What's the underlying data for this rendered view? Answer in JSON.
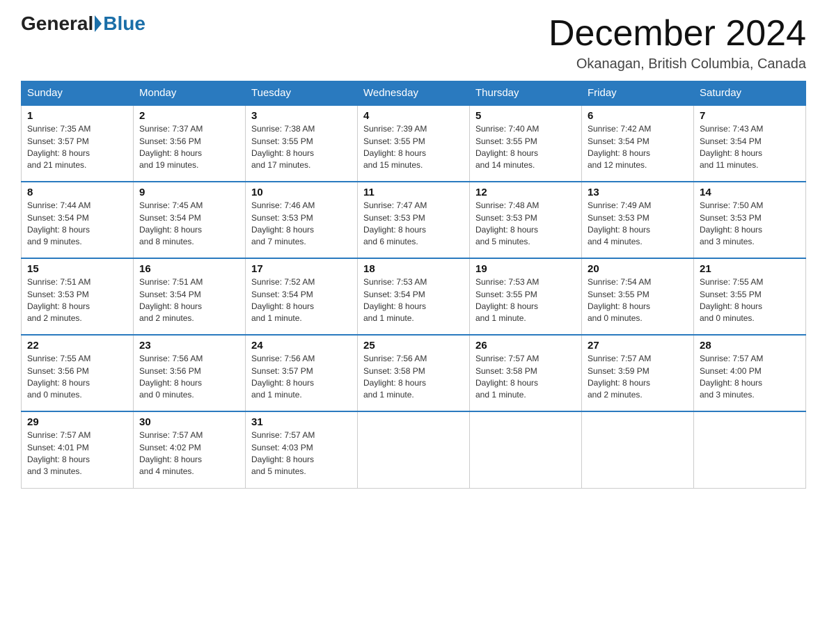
{
  "header": {
    "logo_general": "General",
    "logo_blue": "Blue",
    "month_title": "December 2024",
    "location": "Okanagan, British Columbia, Canada"
  },
  "weekdays": [
    "Sunday",
    "Monday",
    "Tuesday",
    "Wednesday",
    "Thursday",
    "Friday",
    "Saturday"
  ],
  "weeks": [
    [
      {
        "day": "1",
        "sunrise": "7:35 AM",
        "sunset": "3:57 PM",
        "daylight": "8 hours and 21 minutes."
      },
      {
        "day": "2",
        "sunrise": "7:37 AM",
        "sunset": "3:56 PM",
        "daylight": "8 hours and 19 minutes."
      },
      {
        "day": "3",
        "sunrise": "7:38 AM",
        "sunset": "3:55 PM",
        "daylight": "8 hours and 17 minutes."
      },
      {
        "day": "4",
        "sunrise": "7:39 AM",
        "sunset": "3:55 PM",
        "daylight": "8 hours and 15 minutes."
      },
      {
        "day": "5",
        "sunrise": "7:40 AM",
        "sunset": "3:55 PM",
        "daylight": "8 hours and 14 minutes."
      },
      {
        "day": "6",
        "sunrise": "7:42 AM",
        "sunset": "3:54 PM",
        "daylight": "8 hours and 12 minutes."
      },
      {
        "day": "7",
        "sunrise": "7:43 AM",
        "sunset": "3:54 PM",
        "daylight": "8 hours and 11 minutes."
      }
    ],
    [
      {
        "day": "8",
        "sunrise": "7:44 AM",
        "sunset": "3:54 PM",
        "daylight": "8 hours and 9 minutes."
      },
      {
        "day": "9",
        "sunrise": "7:45 AM",
        "sunset": "3:54 PM",
        "daylight": "8 hours and 8 minutes."
      },
      {
        "day": "10",
        "sunrise": "7:46 AM",
        "sunset": "3:53 PM",
        "daylight": "8 hours and 7 minutes."
      },
      {
        "day": "11",
        "sunrise": "7:47 AM",
        "sunset": "3:53 PM",
        "daylight": "8 hours and 6 minutes."
      },
      {
        "day": "12",
        "sunrise": "7:48 AM",
        "sunset": "3:53 PM",
        "daylight": "8 hours and 5 minutes."
      },
      {
        "day": "13",
        "sunrise": "7:49 AM",
        "sunset": "3:53 PM",
        "daylight": "8 hours and 4 minutes."
      },
      {
        "day": "14",
        "sunrise": "7:50 AM",
        "sunset": "3:53 PM",
        "daylight": "8 hours and 3 minutes."
      }
    ],
    [
      {
        "day": "15",
        "sunrise": "7:51 AM",
        "sunset": "3:53 PM",
        "daylight": "8 hours and 2 minutes."
      },
      {
        "day": "16",
        "sunrise": "7:51 AM",
        "sunset": "3:54 PM",
        "daylight": "8 hours and 2 minutes."
      },
      {
        "day": "17",
        "sunrise": "7:52 AM",
        "sunset": "3:54 PM",
        "daylight": "8 hours and 1 minute."
      },
      {
        "day": "18",
        "sunrise": "7:53 AM",
        "sunset": "3:54 PM",
        "daylight": "8 hours and 1 minute."
      },
      {
        "day": "19",
        "sunrise": "7:53 AM",
        "sunset": "3:55 PM",
        "daylight": "8 hours and 1 minute."
      },
      {
        "day": "20",
        "sunrise": "7:54 AM",
        "sunset": "3:55 PM",
        "daylight": "8 hours and 0 minutes."
      },
      {
        "day": "21",
        "sunrise": "7:55 AM",
        "sunset": "3:55 PM",
        "daylight": "8 hours and 0 minutes."
      }
    ],
    [
      {
        "day": "22",
        "sunrise": "7:55 AM",
        "sunset": "3:56 PM",
        "daylight": "8 hours and 0 minutes."
      },
      {
        "day": "23",
        "sunrise": "7:56 AM",
        "sunset": "3:56 PM",
        "daylight": "8 hours and 0 minutes."
      },
      {
        "day": "24",
        "sunrise": "7:56 AM",
        "sunset": "3:57 PM",
        "daylight": "8 hours and 1 minute."
      },
      {
        "day": "25",
        "sunrise": "7:56 AM",
        "sunset": "3:58 PM",
        "daylight": "8 hours and 1 minute."
      },
      {
        "day": "26",
        "sunrise": "7:57 AM",
        "sunset": "3:58 PM",
        "daylight": "8 hours and 1 minute."
      },
      {
        "day": "27",
        "sunrise": "7:57 AM",
        "sunset": "3:59 PM",
        "daylight": "8 hours and 2 minutes."
      },
      {
        "day": "28",
        "sunrise": "7:57 AM",
        "sunset": "4:00 PM",
        "daylight": "8 hours and 3 minutes."
      }
    ],
    [
      {
        "day": "29",
        "sunrise": "7:57 AM",
        "sunset": "4:01 PM",
        "daylight": "8 hours and 3 minutes."
      },
      {
        "day": "30",
        "sunrise": "7:57 AM",
        "sunset": "4:02 PM",
        "daylight": "8 hours and 4 minutes."
      },
      {
        "day": "31",
        "sunrise": "7:57 AM",
        "sunset": "4:03 PM",
        "daylight": "8 hours and 5 minutes."
      },
      null,
      null,
      null,
      null
    ]
  ],
  "labels": {
    "sunrise": "Sunrise:",
    "sunset": "Sunset:",
    "daylight": "Daylight:"
  }
}
